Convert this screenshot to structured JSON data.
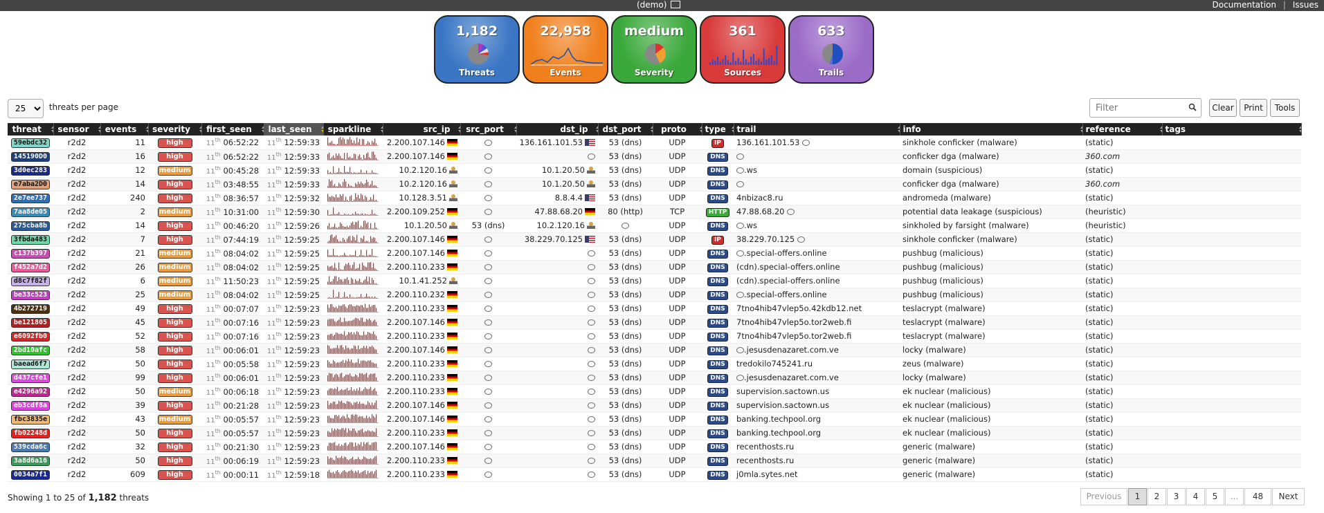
{
  "topbar": {
    "title": "(demo)",
    "links": [
      "Documentation",
      "Issues"
    ]
  },
  "tiles": [
    {
      "value": "1,182",
      "label": "Threats",
      "color": "#3a76c4",
      "chart": "pie-threats"
    },
    {
      "value": "22,958",
      "label": "Events",
      "color": "#f0801e",
      "chart": "line-events"
    },
    {
      "value": "medium",
      "label": "Severity",
      "color": "#3aa83a",
      "chart": "pie-severity"
    },
    {
      "value": "361",
      "label": "Sources",
      "color": "#d93b3b",
      "chart": "bars-sources"
    },
    {
      "value": "633",
      "label": "Trails",
      "color": "#9b6bc8",
      "chart": "pie-trails"
    }
  ],
  "perpage": {
    "selected": "25",
    "label": "threats per page"
  },
  "filter": {
    "placeholder": "Filter"
  },
  "buttons": {
    "clear": "Clear",
    "print": "Print",
    "tools": "Tools"
  },
  "columns": [
    "threat",
    "sensor",
    "events",
    "severity",
    "first_seen",
    "last_seen",
    "sparkline",
    "src_ip",
    "src_port",
    "dst_ip",
    "dst_port",
    "proto",
    "type",
    "trail",
    "info",
    "reference",
    "tags"
  ],
  "rows": [
    {
      "threat": "59ebdc32",
      "tcolor": "#7fd6c8",
      "events": "11",
      "sev": "high",
      "first": "06:52:22",
      "last": "12:59:33",
      "src_ip": "2.200.107.146",
      "src_flag": "de",
      "src_port": "",
      "dst_ip": "136.161.101.53",
      "dst_flag": "us",
      "dst_port": "53 (dns)",
      "proto": "UDP",
      "type": "IP",
      "trail": "136.161.101.53",
      "trail_tip": true,
      "info": "sinkhole conficker (malware)",
      "ref": "(static)"
    },
    {
      "threat": "145190D0",
      "tcolor": "#1f3f7a",
      "events": "16",
      "sev": "high",
      "first": "06:52:22",
      "last": "12:59:33",
      "src_ip": "2.200.107.146",
      "src_flag": "de",
      "src_port": "",
      "dst_ip": "",
      "dst_flag": "",
      "dst_port": "53 (dns)",
      "proto": "UDP",
      "type": "DNS",
      "trail": "",
      "trail_tip": true,
      "info": "conficker dga (malware)",
      "ref": "360.com"
    },
    {
      "threat": "3d0ec283",
      "tcolor": "#1a2a80",
      "events": "12",
      "sev": "medium",
      "first": "00:45:28",
      "last": "12:59:33",
      "src_ip": "10.2.120.16",
      "src_flag": "lan",
      "src_port": "",
      "dst_ip": "10.1.20.50",
      "dst_flag": "lan",
      "dst_port": "53 (dns)",
      "proto": "UDP",
      "type": "DNS",
      "trail": ".ws",
      "trail_tip": true,
      "info": "domain (suspicious)",
      "ref": "(static)"
    },
    {
      "threat": "e7aba2D0",
      "tcolor": "#e0a078",
      "events": "14",
      "sev": "high",
      "first": "03:48:55",
      "last": "12:59:33",
      "src_ip": "10.2.120.16",
      "src_flag": "lan",
      "src_port": "",
      "dst_ip": "10.1.20.50",
      "dst_flag": "lan",
      "dst_port": "53 (dns)",
      "proto": "UDP",
      "type": "DNS",
      "trail": "",
      "trail_tip": true,
      "info": "conficker dga (malware)",
      "ref": "360.com"
    },
    {
      "threat": "2e7ee737",
      "tcolor": "#2c6fb8",
      "events": "240",
      "sev": "high",
      "first": "08:36:57",
      "last": "12:59:32",
      "src_ip": "10.128.3.51",
      "src_flag": "lan",
      "src_port": "",
      "dst_ip": "8.8.4.4",
      "dst_flag": "us",
      "dst_port": "53 (dns)",
      "proto": "UDP",
      "type": "DNS",
      "trail": "4nbizac8.ru",
      "trail_tip": false,
      "info": "andromeda (malware)",
      "ref": "(static)"
    },
    {
      "threat": "7aa8de05",
      "tcolor": "#3a8ab8",
      "events": "2",
      "sev": "medium",
      "first": "10:31:00",
      "last": "12:59:30",
      "src_ip": "2.200.109.252",
      "src_flag": "de",
      "src_port": "",
      "dst_ip": "47.88.68.20",
      "dst_flag": "de",
      "dst_port": "80 (http)",
      "proto": "TCP",
      "type": "HTTP",
      "trail": "47.88.68.20",
      "trail_tip": true,
      "info": "potential data leakage (suspicious)",
      "ref": "(heuristic)"
    },
    {
      "threat": "275cba8b",
      "tcolor": "#2a5a9a",
      "events": "14",
      "sev": "high",
      "first": "00:46:20",
      "last": "12:59:26",
      "src_ip": "10.1.20.50",
      "src_flag": "lan",
      "src_port": "53 (dns)",
      "dst_ip": "10.2.120.16",
      "dst_flag": "lan",
      "dst_port": "",
      "proto": "UDP",
      "type": "DNS",
      "trail": ".ws",
      "trail_tip": true,
      "info": "sinkholed by farsight (malware)",
      "ref": "(heuristic)"
    },
    {
      "threat": "3fbda483",
      "tcolor": "#6fd6a8",
      "events": "7",
      "sev": "high",
      "first": "07:44:19",
      "last": "12:59:25",
      "src_ip": "2.200.107.146",
      "src_flag": "de",
      "src_port": "",
      "dst_ip": "38.229.70.125",
      "dst_flag": "us",
      "dst_port": "53 (dns)",
      "proto": "UDP",
      "type": "IP",
      "trail": "38.229.70.125",
      "trail_tip": true,
      "info": "sinkhole conficker (malware)",
      "ref": "(static)"
    },
    {
      "threat": "c137b397",
      "tcolor": "#c84fb0",
      "events": "21",
      "sev": "medium",
      "first": "08:04:02",
      "last": "12:59:25",
      "src_ip": "2.200.107.146",
      "src_flag": "de",
      "src_port": "",
      "dst_ip": "",
      "dst_flag": "",
      "dst_port": "53 (dns)",
      "proto": "UDP",
      "type": "DNS",
      "trail": ".special-offers.online",
      "trail_tip": true,
      "info": "pushbug (malicious)",
      "ref": "(static)"
    },
    {
      "threat": "f452a7d2",
      "tcolor": "#e85a9a",
      "events": "26",
      "sev": "medium",
      "first": "08:04:02",
      "last": "12:59:25",
      "src_ip": "2.200.110.233",
      "src_flag": "de",
      "src_port": "",
      "dst_ip": "",
      "dst_flag": "",
      "dst_port": "53 (dns)",
      "proto": "UDP",
      "type": "DNS",
      "trail": "(cdn).special-offers.online",
      "trail_tip": false,
      "info": "pushbug (malicious)",
      "ref": "(static)"
    },
    {
      "threat": "d8c7f82f",
      "tcolor": "#c8b0e8",
      "events": "6",
      "sev": "medium",
      "first": "11:50:23",
      "last": "12:59:25",
      "src_ip": "10.1.41.252",
      "src_flag": "lan",
      "src_port": "",
      "dst_ip": "",
      "dst_flag": "",
      "dst_port": "53 (dns)",
      "proto": "UDP",
      "type": "DNS",
      "trail": "(cdn).special-offers.online",
      "trail_tip": false,
      "info": "pushbug (malicious)",
      "ref": "(static)"
    },
    {
      "threat": "be33c523",
      "tcolor": "#c040c0",
      "events": "25",
      "sev": "medium",
      "first": "08:04:02",
      "last": "12:59:25",
      "src_ip": "2.200.110.232",
      "src_flag": "de",
      "src_port": "",
      "dst_ip": "",
      "dst_flag": "",
      "dst_port": "53 (dns)",
      "proto": "UDP",
      "type": "DNS",
      "trail": ".special-offers.online",
      "trail_tip": true,
      "info": "pushbug (malicious)",
      "ref": "(static)"
    },
    {
      "threat": "4b272719",
      "tcolor": "#4a3010",
      "events": "49",
      "sev": "high",
      "first": "00:07:07",
      "last": "12:59:23",
      "src_ip": "2.200.110.233",
      "src_flag": "de",
      "src_port": "",
      "dst_ip": "",
      "dst_flag": "",
      "dst_port": "53 (dns)",
      "proto": "UDP",
      "type": "DNS",
      "trail": "7tno4hib47vlep5o.42kdb12.net",
      "trail_tip": false,
      "info": "teslacrypt (malware)",
      "ref": "(static)"
    },
    {
      "threat": "be121805",
      "tcolor": "#b02020",
      "events": "45",
      "sev": "high",
      "first": "00:07:16",
      "last": "12:59:23",
      "src_ip": "2.200.107.146",
      "src_flag": "de",
      "src_port": "",
      "dst_ip": "",
      "dst_flag": "",
      "dst_port": "53 (dns)",
      "proto": "UDP",
      "type": "DNS",
      "trail": "7tno4hib47vlep5o.tor2web.fi",
      "trail_tip": false,
      "info": "teslacrypt (malware)",
      "ref": "(static)"
    },
    {
      "threat": "e6092fb0",
      "tcolor": "#d02828",
      "events": "52",
      "sev": "high",
      "first": "00:07:16",
      "last": "12:59:23",
      "src_ip": "2.200.110.233",
      "src_flag": "de",
      "src_port": "",
      "dst_ip": "",
      "dst_flag": "",
      "dst_port": "53 (dns)",
      "proto": "UDP",
      "type": "DNS",
      "trail": "7tno4hib47vlep5o.tor2web.fi",
      "trail_tip": false,
      "info": "teslacrypt (malware)",
      "ref": "(static)"
    },
    {
      "threat": "2bd10afc",
      "tcolor": "#30c030",
      "events": "58",
      "sev": "high",
      "first": "00:06:01",
      "last": "12:59:23",
      "src_ip": "2.200.107.146",
      "src_flag": "de",
      "src_port": "",
      "dst_ip": "",
      "dst_flag": "",
      "dst_port": "53 (dns)",
      "proto": "UDP",
      "type": "DNS",
      "trail": ".jesusdenazaret.com.ve",
      "trail_tip": true,
      "info": "locky (malware)",
      "ref": "(static)"
    },
    {
      "threat": "baead6f7",
      "tcolor": "#b0e8d8",
      "events": "50",
      "sev": "high",
      "first": "00:05:58",
      "last": "12:59:23",
      "src_ip": "2.200.110.233",
      "src_flag": "de",
      "src_port": "",
      "dst_ip": "",
      "dst_flag": "",
      "dst_port": "53 (dns)",
      "proto": "UDP",
      "type": "DNS",
      "trail": "tredokilo745241.ru",
      "trail_tip": false,
      "info": "zeus (malware)",
      "ref": "(static)"
    },
    {
      "threat": "d437cfe1",
      "tcolor": "#d84ad8",
      "events": "99",
      "sev": "high",
      "first": "00:06:01",
      "last": "12:59:23",
      "src_ip": "2.200.110.233",
      "src_flag": "de",
      "src_port": "",
      "dst_ip": "",
      "dst_flag": "",
      "dst_port": "53 (dns)",
      "proto": "UDP",
      "type": "DNS",
      "trail": ".jesusdenazaret.com.ve",
      "trail_tip": true,
      "info": "locky (malware)",
      "ref": "(static)"
    },
    {
      "threat": "e4296a92",
      "tcolor": "#c02890",
      "events": "50",
      "sev": "medium",
      "first": "00:06:18",
      "last": "12:59:23",
      "src_ip": "2.200.110.233",
      "src_flag": "de",
      "src_port": "",
      "dst_ip": "",
      "dst_flag": "",
      "dst_port": "53 (dns)",
      "proto": "UDP",
      "type": "DNS",
      "trail": "supervision.sactown.us",
      "trail_tip": false,
      "info": "ek nuclear (malicious)",
      "ref": "(static)"
    },
    {
      "threat": "eb3cdf8a",
      "tcolor": "#e040e0",
      "events": "39",
      "sev": "high",
      "first": "00:21:28",
      "last": "12:59:23",
      "src_ip": "2.200.107.146",
      "src_flag": "de",
      "src_port": "",
      "dst_ip": "",
      "dst_flag": "",
      "dst_port": "53 (dns)",
      "proto": "UDP",
      "type": "DNS",
      "trail": "supervision.sactown.us",
      "trail_tip": false,
      "info": "ek nuclear (malicious)",
      "ref": "(static)"
    },
    {
      "threat": "fbc3835e",
      "tcolor": "#f0b870",
      "events": "43",
      "sev": "medium",
      "first": "00:05:57",
      "last": "12:59:23",
      "src_ip": "2.200.107.146",
      "src_flag": "de",
      "src_port": "",
      "dst_ip": "",
      "dst_flag": "",
      "dst_port": "53 (dns)",
      "proto": "UDP",
      "type": "DNS",
      "trail": "banking.techpool.org",
      "trail_tip": false,
      "info": "ek nuclear (malicious)",
      "ref": "(static)"
    },
    {
      "threat": "fb02248d",
      "tcolor": "#e82020",
      "events": "50",
      "sev": "high",
      "first": "00:05:57",
      "last": "12:59:23",
      "src_ip": "2.200.110.233",
      "src_flag": "de",
      "src_port": "",
      "dst_ip": "",
      "dst_flag": "",
      "dst_port": "53 (dns)",
      "proto": "UDP",
      "type": "DNS",
      "trail": "banking.techpool.org",
      "trail_tip": false,
      "info": "ek nuclear (malicious)",
      "ref": "(static)"
    },
    {
      "threat": "539cda6c",
      "tcolor": "#4a7ab0",
      "events": "32",
      "sev": "high",
      "first": "00:21:30",
      "last": "12:59:23",
      "src_ip": "2.200.107.146",
      "src_flag": "de",
      "src_port": "",
      "dst_ip": "",
      "dst_flag": "",
      "dst_port": "53 (dns)",
      "proto": "UDP",
      "type": "DNS",
      "trail": "recenthosts.ru",
      "trail_tip": false,
      "info": "generic (malware)",
      "ref": "(static)"
    },
    {
      "threat": "3a8d6a16",
      "tcolor": "#3a9a5a",
      "events": "50",
      "sev": "high",
      "first": "00:06:19",
      "last": "12:59:23",
      "src_ip": "2.200.110.233",
      "src_flag": "de",
      "src_port": "",
      "dst_ip": "",
      "dst_flag": "",
      "dst_port": "53 (dns)",
      "proto": "UDP",
      "type": "DNS",
      "trail": "recenthosts.ru",
      "trail_tip": false,
      "info": "generic (malware)",
      "ref": "(static)"
    },
    {
      "threat": "0034a7f1",
      "tcolor": "#1a2a90",
      "events": "609",
      "sev": "high",
      "first": "00:00:11",
      "last": "12:59:18",
      "src_ip": "2.200.110.233",
      "src_flag": "de",
      "src_port": "",
      "dst_ip": "",
      "dst_flag": "",
      "dst_port": "53 (dns)",
      "proto": "UDP",
      "type": "DNS",
      "trail": "j0mla.sytes.net",
      "trail_tip": false,
      "info": "generic (malware)",
      "ref": "(static)"
    }
  ],
  "common": {
    "sensor": "r2d2",
    "day": "11",
    "day_suffix": "th"
  },
  "footer": {
    "showing_prefix": "Showing 1 to 25 of",
    "total": "1,182",
    "showing_suffix": "threats"
  },
  "pager": [
    "Previous",
    "1",
    "2",
    "3",
    "4",
    "5",
    "...",
    "48",
    "Next"
  ],
  "colors": {
    "header_bg": "#222222",
    "sev_high": "#d9534f",
    "sev_medium": "#e89d3a",
    "spark": "#e02020"
  }
}
